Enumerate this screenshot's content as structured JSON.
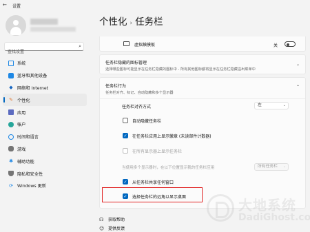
{
  "window": {
    "title": "设置"
  },
  "search": {
    "placeholder": "查找设置"
  },
  "nav": {
    "items": [
      {
        "label": "系统",
        "icon": "monitor-icon",
        "color": "#1e88e5"
      },
      {
        "label": "蓝牙和其他设备",
        "icon": "bluetooth-icon",
        "color": "#1e88e5"
      },
      {
        "label": "网络和 Internet",
        "icon": "wifi-icon",
        "color": "#1565c0"
      },
      {
        "label": "个性化",
        "icon": "pen-icon",
        "color": "#e07b39"
      },
      {
        "label": "应用",
        "icon": "apps-icon",
        "color": "#5c6bc0"
      },
      {
        "label": "帐户",
        "icon": "person-icon",
        "color": "#26a69a"
      },
      {
        "label": "时间和语言",
        "icon": "globe-icon",
        "color": "#1e88e5"
      },
      {
        "label": "游戏",
        "icon": "gamepad-icon",
        "color": "#757575"
      },
      {
        "label": "辅助功能",
        "icon": "accessibility-icon",
        "color": "#1e88e5"
      },
      {
        "label": "隐私和安全性",
        "icon": "shield-icon",
        "color": "#757575"
      },
      {
        "label": "Windows 更新",
        "icon": "update-icon",
        "color": "#1e88e5"
      }
    ]
  },
  "breadcrumb": {
    "parent": "个性化",
    "current": "任务栏"
  },
  "touchpad": {
    "label": "虚拟触摸板",
    "toggle_text": "关"
  },
  "overflow": {
    "title": "任务栏隐藏的图标管理",
    "subtitle": "选择哪些图标可能显示在任务栏隐藏的图标中 - 所有其他图标都将显示在任务栏隐藏溢出菜单中"
  },
  "behaviors": {
    "title": "任务栏行为",
    "subtitle": "任务栏对齐、标记、自动隐藏和多个显示器",
    "alignment": {
      "label": "任务栏对齐方式",
      "value": "左"
    },
    "options": [
      {
        "label": "自动隐藏任务栏",
        "checked": false,
        "enabled": true
      },
      {
        "label": "在任务栏应用上显示徽章 (未读邮件计数器)",
        "checked": true,
        "enabled": true
      },
      {
        "label": "在所有显示器上显示任务栏",
        "checked": false,
        "enabled": false
      }
    ],
    "multi_display": {
      "label": "当使用多个显示器时，在以下位置显示我的任务栏应用",
      "value": "所有任务栏"
    },
    "share_window": {
      "label": "从任务栏共享任何窗口",
      "checked": true
    },
    "far_corner": {
      "label": "选择任务栏的远角以显示桌面",
      "checked": true
    }
  },
  "footer": {
    "help": "获取帮助",
    "feedback": "提供反馈"
  },
  "watermark": {
    "cn": "大地系统",
    "en": "DadiGhost.com"
  }
}
